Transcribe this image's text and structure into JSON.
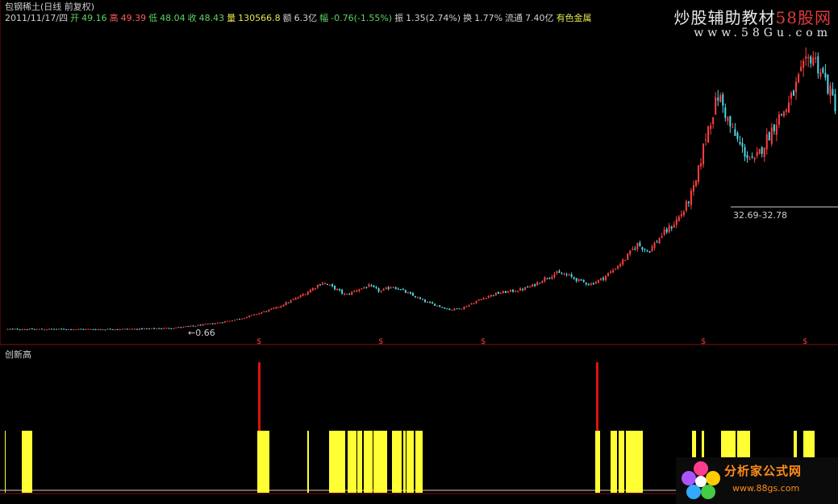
{
  "header": {
    "title": "包钢稀土(日线 前复权)",
    "date": "2011/11/17/四",
    "open_label": "开",
    "open": "49.16",
    "high_label": "高",
    "high": "49.39",
    "low_label": "低",
    "low": "48.04",
    "close_label": "收",
    "close": "48.43",
    "volume_label": "量",
    "volume": "130566.8",
    "amount_label": "额",
    "amount": "6.3亿",
    "change_label": "幅",
    "change": "-0.76(-1.55%)",
    "amplitude_label": "振",
    "amplitude": "1.35(2.74%)",
    "turnover_label": "换",
    "turnover": "1.77%",
    "float_label": "流通",
    "float": "7.40亿",
    "sector": "有色金属"
  },
  "watermark_top": {
    "text_a": "炒股辅助教材",
    "text_b": "58股网",
    "url": "www.58Gu.com"
  },
  "watermark_bottom": {
    "text": "分析家公式网",
    "url": "www.88gs.com"
  },
  "annotations": {
    "low_value": "←0.66",
    "range_label": "32.69-32.78"
  },
  "indicator": {
    "title": "创新高"
  },
  "colors": {
    "up": "#ff4040",
    "down": "#4fd8e8",
    "yellow": "#ffff33",
    "red_bar": "#dd1111",
    "axis_red": "#9a1010"
  },
  "chart_data": [
    {
      "type": "candlestick",
      "title": "包钢稀土(日线 前复权)",
      "approx_close_series": [
        0.7,
        0.7,
        0.68,
        0.68,
        0.7,
        0.69,
        0.67,
        0.66,
        0.68,
        0.7,
        0.72,
        0.75,
        0.8,
        0.9,
        1.0,
        1.3,
        1.6,
        2.0,
        2.4,
        3.0,
        3.6,
        4.5,
        5.5,
        6.5,
        8.0,
        9.5,
        11.5,
        13.5,
        12.0,
        10.0,
        11.5,
        12.5,
        11.0,
        12.5,
        11.0,
        9.5,
        8.0,
        7.0,
        6.0,
        6.5,
        8.0,
        9.5,
        10.5,
        11.0,
        11.5,
        12.5,
        14.5,
        16.0,
        15.5,
        14.0,
        13.0,
        14.5,
        17.0,
        20.0,
        24.0,
        22.0,
        26.0,
        29.0,
        33.0,
        40.0,
        55.0,
        65.0,
        56.0,
        50.0,
        46.0,
        52.0,
        58.0,
        62.0,
        70.0,
        76.0,
        70.0,
        62.0
      ],
      "ylim": [
        0,
        78
      ]
    },
    {
      "type": "bar",
      "title": "创新高",
      "description": "yellow = new-high signal bars, red = tall spike signals",
      "yellow_bars": [
        6,
        27,
        28,
        29,
        30,
        31,
        32,
        33,
        34,
        35,
        36,
        37,
        38,
        39,
        319,
        320,
        321,
        322,
        323,
        324,
        325,
        326,
        327,
        328,
        329,
        330,
        331,
        332,
        333,
        381,
        382,
        408,
        409,
        410,
        411,
        412,
        413,
        414,
        415,
        416,
        417,
        418,
        419,
        420,
        421,
        422,
        423,
        424,
        425,
        426,
        427,
        431,
        432,
        433,
        434,
        435,
        436,
        437,
        438,
        439,
        440,
        441,
        443,
        444,
        445,
        446,
        447,
        448,
        451,
        452,
        453,
        454,
        455,
        456,
        457,
        458,
        459,
        460,
        461,
        463,
        464,
        465,
        466,
        467,
        468,
        469,
        470,
        471,
        472,
        473,
        474,
        475,
        476,
        477,
        478,
        479,
        486,
        487,
        488,
        489,
        490,
        491,
        492,
        493,
        494,
        495,
        496,
        497,
        500,
        501,
        502,
        504,
        505,
        506,
        507,
        508,
        509,
        510,
        511,
        512,
        515,
        516,
        517,
        518,
        519,
        520,
        521,
        522,
        523,
        738,
        739,
        740,
        741,
        742,
        743,
        757,
        758,
        759,
        760,
        761,
        762,
        763,
        764,
        767,
        768,
        769,
        770,
        771,
        772,
        773,
        776,
        777,
        778,
        779,
        780,
        781,
        782,
        783,
        784,
        785,
        786,
        787,
        788,
        789,
        790,
        791,
        792,
        793,
        794,
        795,
        796,
        858,
        859,
        860,
        861,
        862,
        870,
        871,
        872,
        894,
        895,
        896,
        897,
        898,
        899,
        900,
        901,
        902,
        903,
        904,
        905,
        906,
        907,
        908,
        909,
        910,
        911,
        914,
        915,
        916,
        917,
        918,
        919,
        920,
        921,
        922,
        923,
        924,
        925,
        926,
        927,
        928,
        929,
        984,
        985,
        986,
        987,
        996,
        997,
        998,
        999,
        1000,
        1001,
        1002,
        1003,
        1004,
        1005,
        1006,
        1007,
        1008,
        1009
      ],
      "red_spikes": [
        321,
        740
      ]
    }
  ]
}
